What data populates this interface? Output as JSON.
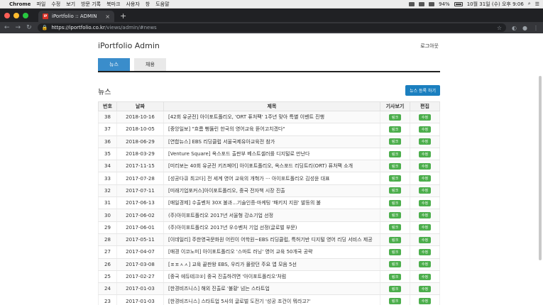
{
  "menubar": {
    "app_name": "Chrome",
    "items": [
      "파일",
      "수정",
      "보기",
      "방문 기록",
      "북마크",
      "사용자",
      "창",
      "도움말"
    ],
    "battery": "94%",
    "clock": "10월 31일 (수) 오후 9:06"
  },
  "browser": {
    "tab_title": "iPortfolio :: ADMIN",
    "favicon_text": "IP",
    "url_host": "https://iportfolio.co.kr",
    "url_path": "/views/admin/#news"
  },
  "page": {
    "site_title": "iPortfolio Admin",
    "logout_label": "로그아웃",
    "tabs": [
      {
        "label": "뉴스",
        "active": true
      },
      {
        "label": "채용",
        "active": false
      }
    ],
    "section_title": "뉴스",
    "add_button_label": "뉴스 등록 하기",
    "columns": [
      "번호",
      "날짜",
      "제목",
      "기사보기",
      "편집"
    ],
    "link_label": "링크",
    "edit_label": "수정",
    "rows": [
      {
        "num": "38",
        "date": "2018-10-16",
        "title": "[42회 유균전] 아이포트폴리오, 'ORT 퓨처팩' 1주년 맞아 특별 이벤트 진행"
      },
      {
        "num": "37",
        "date": "2018-10-05",
        "title": "[중앙일보] \"흐름 뻥뚫린 한국의 영어교육 뜯어고치겠다\""
      },
      {
        "num": "36",
        "date": "2018-06-29",
        "title": "[연합뉴스] EBS 리딩클럽 서울국제유아교육전 참가"
      },
      {
        "num": "35",
        "date": "2018-03-29",
        "title": "[Venture Square] 옥스포드 출판부 베스트셀러를 디지털로 만난다"
      },
      {
        "num": "34",
        "date": "2017-11-15",
        "title": "[미리보는 40회 유균전 키즈페어] 아이포트폴리오, 옥스포드 리딩트리(ORT) 퓨처팩 소개"
      },
      {
        "num": "33",
        "date": "2017-07-28",
        "title": "[성공다큐 최고다] 전 세계 영어 교육의 개혁가 ··· 아이포트폴리오 김성윤 대표"
      },
      {
        "num": "32",
        "date": "2017-07-11",
        "title": "[미래기업포커스]아이포트폴리오, 중국 전자책 시장 진출"
      },
      {
        "num": "31",
        "date": "2017-06-13",
        "title": "[매일경제] 수출벤처 30X 불과...기술인증·마케팅 '패키지 지원' 발등의 불"
      },
      {
        "num": "30",
        "date": "2017-06-02",
        "title": "(주)아이포트폴리오 2017년 서울형 강소기업 선정"
      },
      {
        "num": "29",
        "date": "2017-06-01",
        "title": "(주)아이포트폴리오 2017년 우수벤처 기업 선정(글로벌 부문)"
      },
      {
        "num": "28",
        "date": "2017-05-11",
        "title": "[이데일리] 주한영국문화원 어린이 어학원~EBS 리딩클럽, 특허기반 디지털 영어 리딩 서비스 제공"
      },
      {
        "num": "27",
        "date": "2017-04-07",
        "title": "[매경 이코노미] 아이포트폴리오 '스마트 러닝' 영어 교육 50개국 공략"
      },
      {
        "num": "26",
        "date": "2017-03-08",
        "title": "[ㅍㅍㅅㅅ] 교육 끝판왕 EBS, 우리가 몰랐던 주요 앱 모음 5선"
      },
      {
        "num": "25",
        "date": "2017-02-27",
        "title": "[중국 에듀테크②] 중국 진출하려면 '아이포트폴리오'처럼"
      },
      {
        "num": "24",
        "date": "2017-01-03",
        "title": "[한경비즈니스] 해외 진출로 '불황' 넘는 스타트업"
      },
      {
        "num": "23",
        "date": "2017-01-03",
        "title": "[한경비즈니스] 스타트업 5사의 글로벌 도전기 '성공 조건이 뭐라고?'"
      }
    ]
  },
  "colors": {
    "primary": "#3a8dcb",
    "add_button": "#1b7fbf",
    "green_button": "#4cae4c"
  }
}
